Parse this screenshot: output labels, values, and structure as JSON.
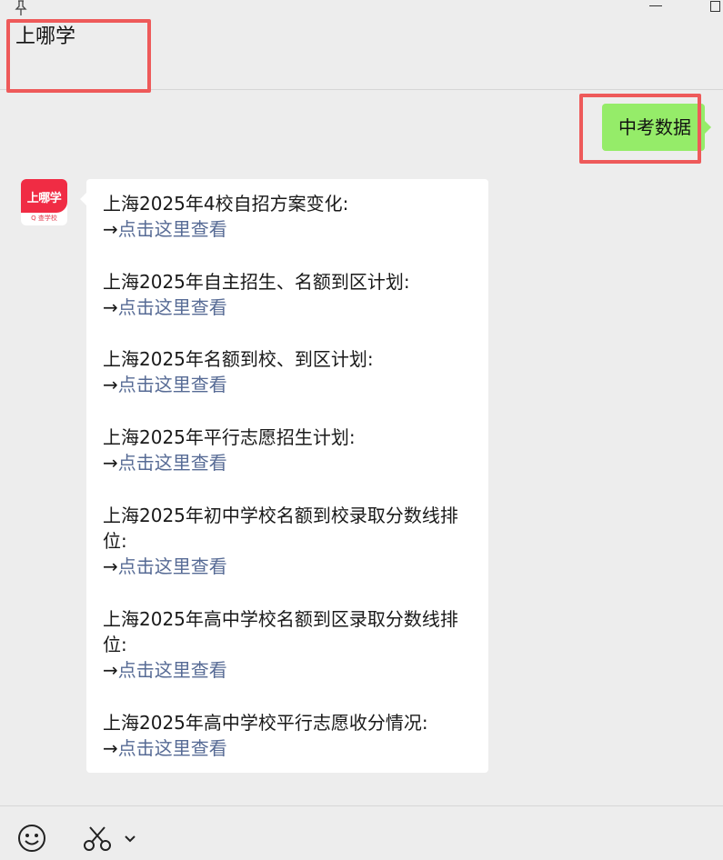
{
  "window": {
    "pin_icon": "pin-icon",
    "minimize_icon": "minimize-icon",
    "maximize_icon": "maximize-icon"
  },
  "chat": {
    "title": "上哪学"
  },
  "sent_message": {
    "text": "中考数据",
    "bubble_color": "#95ec69"
  },
  "contact": {
    "avatar_label": "上哪学",
    "avatar_sub": "Q 查学校",
    "avatar_color": "#f02c44"
  },
  "reply": {
    "arrow": "→",
    "link_color": "#576b95",
    "entries": [
      {
        "lines": [
          "上海2025年4校自招方案变化:"
        ],
        "link": "点击这里查看"
      },
      {
        "lines": [
          "上海2025年自主招生、名额到区计划:"
        ],
        "link": "点击这里查看"
      },
      {
        "lines": [
          "上海2025年名额到校、到区计划:"
        ],
        "link": "点击这里查看"
      },
      {
        "lines": [
          "上海2025年平行志愿招生计划:"
        ],
        "link": "点击这里查看"
      },
      {
        "lines": [
          "上海2025年初中学校名额到校录取分数线排",
          "位:"
        ],
        "link": "点击这里查看"
      },
      {
        "lines": [
          "上海2025年高中学校名额到区录取分数线排",
          "位:"
        ],
        "link": "点击这里查看"
      },
      {
        "lines": [
          "上海2025年高中学校平行志愿收分情况:"
        ],
        "link": "点击这里查看"
      }
    ]
  },
  "toolbar": {
    "emoji_icon": "emoji-icon",
    "scissors_icon": "scissors-icon",
    "chevron_icon": "chevron-down-icon"
  },
  "highlight_color": "#ee5a5a"
}
